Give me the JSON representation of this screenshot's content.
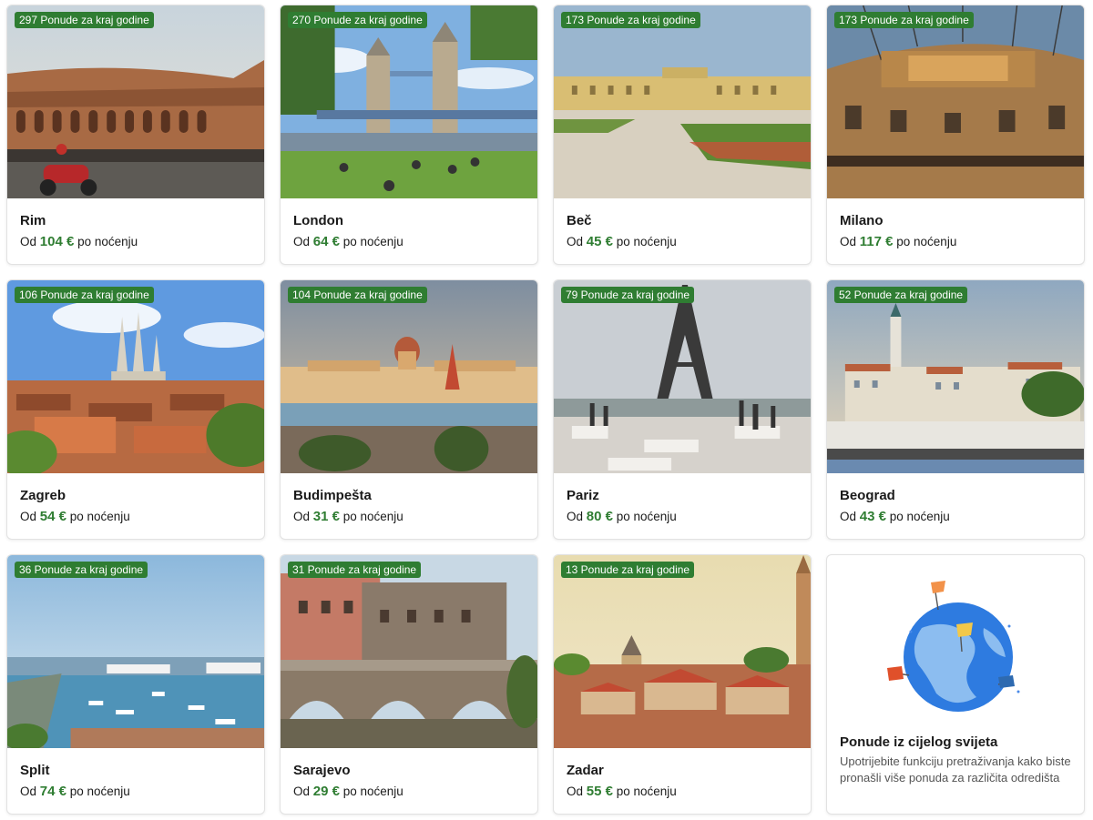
{
  "cards": [
    {
      "badge": "297 Ponude za kraj godine",
      "city": "Rim",
      "from": "Od",
      "price": "104 €",
      "per": "po noćenju",
      "image": "colosseum"
    },
    {
      "badge": "270 Ponude za kraj godine",
      "city": "London",
      "from": "Od",
      "price": "64 €",
      "per": "po noćenju",
      "image": "tower-bridge"
    },
    {
      "badge": "173 Ponude za kraj godine",
      "city": "Beč",
      "from": "Od",
      "price": "45 €",
      "per": "po noćenju",
      "image": "schonbrunn-palace"
    },
    {
      "badge": "173 Ponude za kraj godine",
      "city": "Milano",
      "from": "Od",
      "price": "117 €",
      "per": "po noćenju",
      "image": "galleria"
    },
    {
      "badge": "106 Ponude za kraj godine",
      "city": "Zagreb",
      "from": "Od",
      "price": "54 €",
      "per": "po noćenju",
      "image": "cathedral"
    },
    {
      "badge": "104 Ponude za kraj godine",
      "city": "Budimpešta",
      "from": "Od",
      "price": "31 €",
      "per": "po noćenju",
      "image": "parliament"
    },
    {
      "badge": "79 Ponude za kraj godine",
      "city": "Pariz",
      "from": "Od",
      "price": "80 €",
      "per": "po noćenju",
      "image": "eiffel-tower"
    },
    {
      "badge": "52 Ponude za kraj godine",
      "city": "Beograd",
      "from": "Od",
      "price": "43 €",
      "per": "po noćenju",
      "image": "riverside-city"
    },
    {
      "badge": "36 Ponude za kraj godine",
      "city": "Split",
      "from": "Od",
      "price": "74 €",
      "per": "po noćenju",
      "image": "harbor"
    },
    {
      "badge": "31 Ponude za kraj godine",
      "city": "Sarajevo",
      "from": "Od",
      "price": "29 €",
      "per": "po noćenju",
      "image": "stone-bridge"
    },
    {
      "badge": "13 Ponude za kraj godine",
      "city": "Zadar",
      "from": "Od",
      "price": "55 €",
      "per": "po noćenju",
      "image": "old-town-rooftops"
    }
  ],
  "world": {
    "title": "Ponude iz cijelog svijeta",
    "description": "Upotrijebite funkciju pretraživanja kako biste pronašli više ponuda za različita odredišta",
    "icon": "globe-icon"
  },
  "colors": {
    "badge": "#2f7d32",
    "price": "#2f7d32"
  }
}
